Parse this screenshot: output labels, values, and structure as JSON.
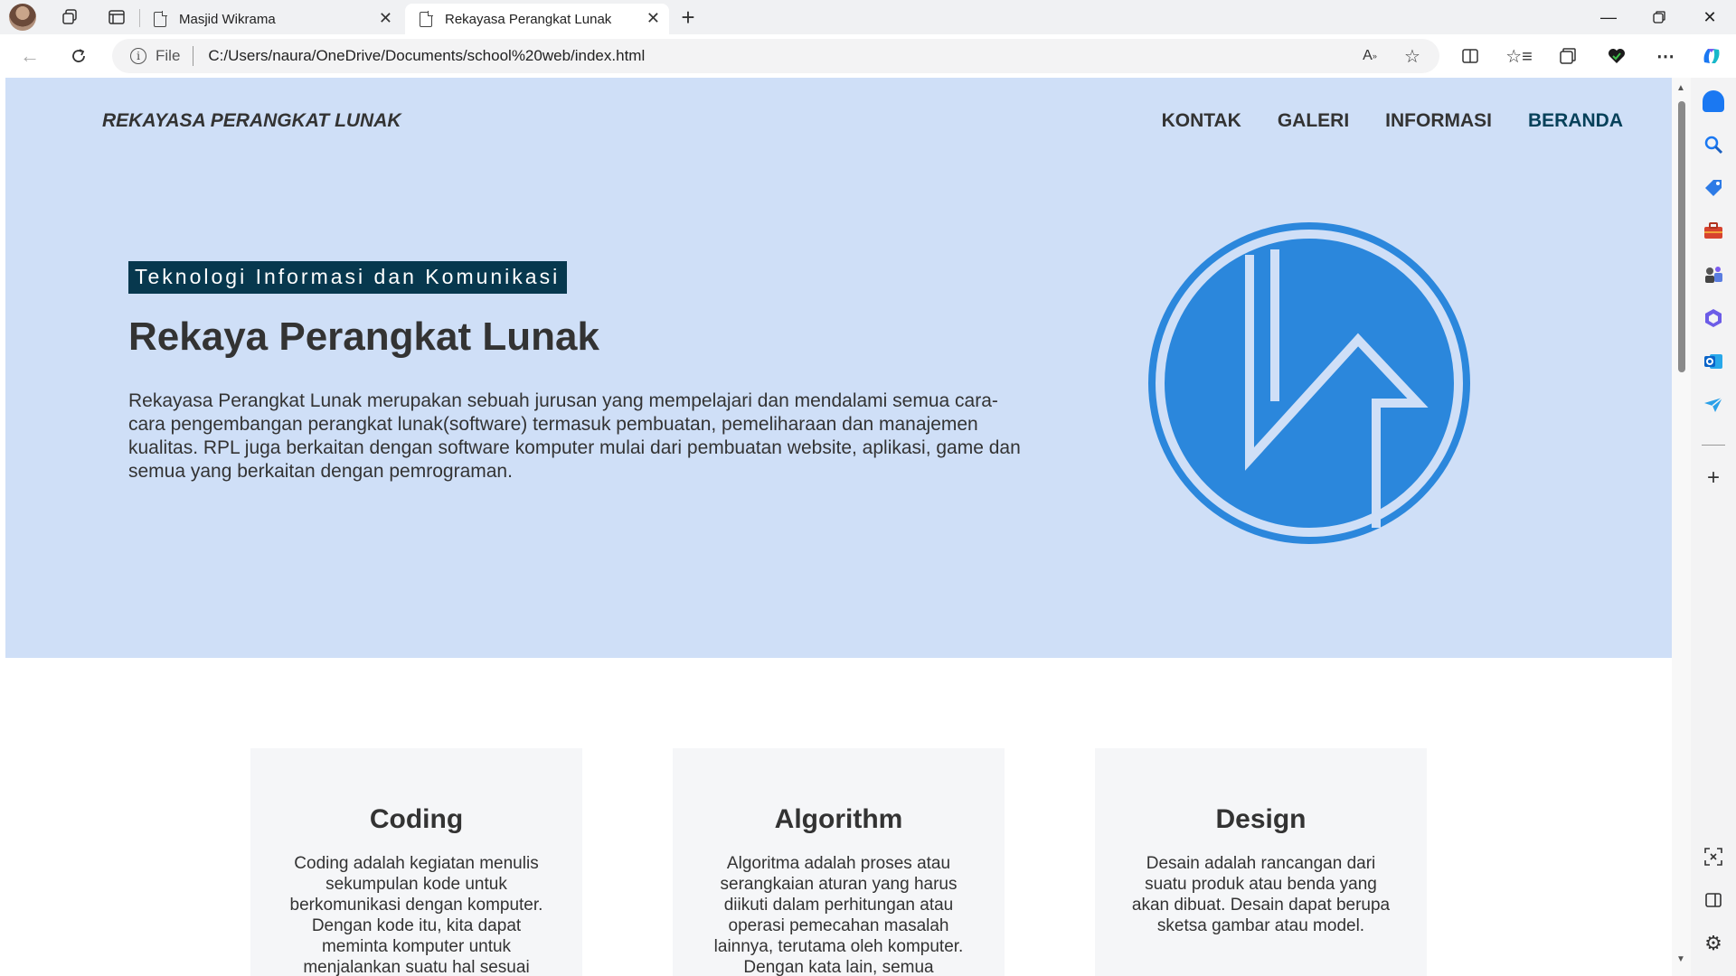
{
  "browser": {
    "tabs": [
      {
        "title": "Masjid Wikrama",
        "active": false
      },
      {
        "title": "Rekayasa Perangkat Lunak",
        "active": true
      }
    ],
    "address": {
      "scheme_label": "File",
      "url": "C:/Users/naura/OneDrive/Documents/school%20web/index.html"
    }
  },
  "site": {
    "brand": "REKAYASA PERANGKAT LUNAK",
    "nav": [
      {
        "label": "KONTAK"
      },
      {
        "label": "GALERI"
      },
      {
        "label": "INFORMASI"
      },
      {
        "label": "BERANDA",
        "active": true
      }
    ],
    "hero": {
      "tag": "Teknologi Informasi dan Komunikasi",
      "title": "Rekaya Perangkat Lunak",
      "description": "Rekayasa Perangkat Lunak merupakan sebuah jurusan yang mempelajari dan mendalami semua cara-cara pengembangan perangkat lunak(software) termasuk pembuatan, pemeliharaan dan manajemen kualitas. RPL juga berkaitan dengan software komputer mulai dari pembuatan website, aplikasi, game dan semua yang berkaitan dengan pemrograman."
    },
    "cards": [
      {
        "title": "Coding",
        "text": "Coding adalah kegiatan menulis sekumpulan kode untuk berkomunikasi dengan komputer. Dengan kode itu, kita dapat meminta komputer untuk menjalankan suatu hal sesuai"
      },
      {
        "title": "Algorithm",
        "text": "Algoritma adalah proses atau serangkaian aturan yang harus diikuti dalam perhitungan atau operasi pemecahan masalah lainnya, terutama oleh komputer. Dengan kata lain, semua"
      },
      {
        "title": "Design",
        "text": "Desain adalah rancangan dari suatu produk atau benda yang akan dibuat. Desain dapat berupa sketsa gambar atau model."
      }
    ]
  },
  "colors": {
    "hero_bg": "#cfdff7",
    "tag_bg": "#07384e",
    "logo_blue": "#2b87dc",
    "active_nav": "#07415a",
    "card_bg": "#f5f6f8"
  },
  "icons": [
    "back-arrow-icon",
    "refresh-icon",
    "info-icon",
    "read-aloud-icon",
    "favorite-star-icon",
    "split-screen-icon",
    "favorites-icon",
    "collections-icon",
    "browser-essentials-icon",
    "more-icon",
    "copilot-icon"
  ]
}
